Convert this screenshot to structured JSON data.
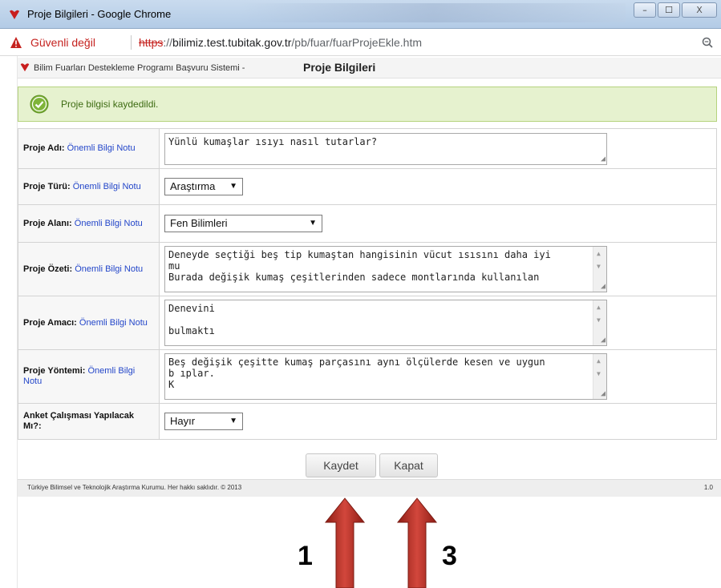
{
  "window": {
    "title": "Proje Bilgileri - Google Chrome",
    "min": "–",
    "max": "☐",
    "close": "X"
  },
  "address": {
    "insecure_label": "Güvenli değil",
    "scheme": "https",
    "rest_prefix": "://",
    "host": "bilimiz.test.tubitak.gov.tr",
    "path": "/pb/fuar/fuarProjeEkle.htm"
  },
  "header": {
    "system_name": "Bilim Fuarları Destekleme Programı Başvuru Sistemi -",
    "page_title": "Proje Bilgileri"
  },
  "message": {
    "success": "Proje bilgisi kaydedildi."
  },
  "note_label": "Önemli Bilgi Notu",
  "form": {
    "ad_label": "Proje Adı:",
    "ad_value": "Yünlü kumaşlar ısıyı nasıl tutarlar?",
    "tur_label": "Proje Türü:",
    "tur_value": "Araştırma",
    "alan_label": "Proje Alanı:",
    "alan_value": "Fen Bilimleri",
    "ozet_label": "Proje Özeti:",
    "ozet_lines": [
      "Deneyde seçtiği beş tip kumaştan hangisinin vücut ısısını daha iyi",
      "mu",
      "Burada değişik kumaş çeşitlerinden sadece montlarında kullanılan"
    ],
    "amac_label": "Proje Amacı:",
    "amac_lines": [
      "Denevini",
      "",
      "bulmaktı"
    ],
    "yontem_label": "Proje Yöntemi:",
    "yontem_lines": [
      "Beş değişik çeşitte kumaş parçasını aynı ölçülerde kesen ve uygun",
      "b                                                           ıplar.",
      "K"
    ],
    "anket_label": "Anket Çalışması Yapılacak Mı?:",
    "anket_value": "Hayır"
  },
  "buttons": {
    "save": "Kaydet",
    "close": "Kapat"
  },
  "footer": {
    "copyright": "Türkiye Bilimsel ve Teknolojik Araştırma Kurumu. Her hakkı saklıdır. © 2013",
    "version": "1.0"
  },
  "annotations": {
    "left": "1",
    "right": "3",
    "arrow_color": "#c0352b"
  },
  "colors": {
    "success_bg": "#e6f2cf",
    "success_text": "#3d6b12",
    "link": "#2346c9",
    "insecure": "#c5221f"
  }
}
